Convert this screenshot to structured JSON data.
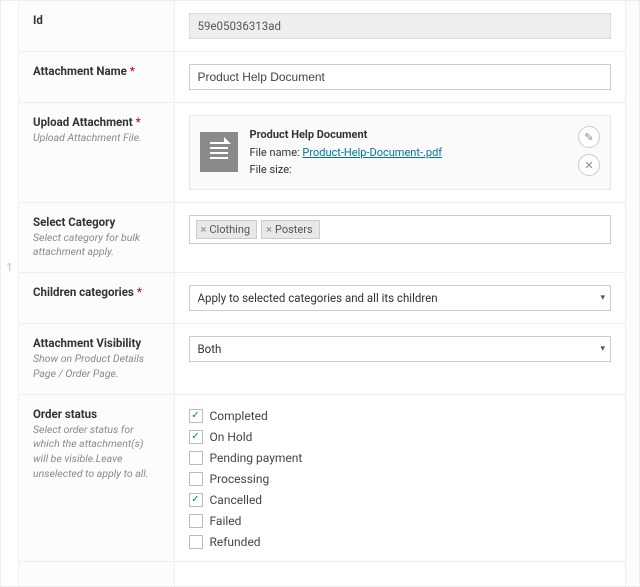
{
  "gutter_index": "1",
  "id": {
    "label": "Id",
    "value": "59e05036313ad"
  },
  "attachment_name": {
    "label": "Attachment Name",
    "value": "Product Help Document"
  },
  "upload": {
    "label": "Upload Attachment",
    "desc": "Upload Attachment File.",
    "file_title": "Product Help Document",
    "file_name_label": "File name: ",
    "file_name": "Product-Help-Document-.pdf",
    "file_size_label": "File size:",
    "file_size": ""
  },
  "category": {
    "label": "Select Category",
    "desc": "Select category for bulk attachment apply.",
    "tags": [
      "Clothing",
      "Posters"
    ]
  },
  "children": {
    "label": "Children categories",
    "value": "Apply to selected categories and all its children"
  },
  "visibility": {
    "label": "Attachment Visibility",
    "desc": "Show on Product Details Page / Order Page.",
    "value": "Both"
  },
  "order_status": {
    "label": "Order status",
    "desc": "Select order status for which the attachment(s) will be visible.Leave unselected to apply to all.",
    "options": [
      {
        "label": "Completed",
        "checked": true
      },
      {
        "label": "On Hold",
        "checked": true
      },
      {
        "label": "Pending payment",
        "checked": false
      },
      {
        "label": "Processing",
        "checked": false
      },
      {
        "label": "Cancelled",
        "checked": true
      },
      {
        "label": "Failed",
        "checked": false
      },
      {
        "label": "Refunded",
        "checked": false
      }
    ]
  }
}
